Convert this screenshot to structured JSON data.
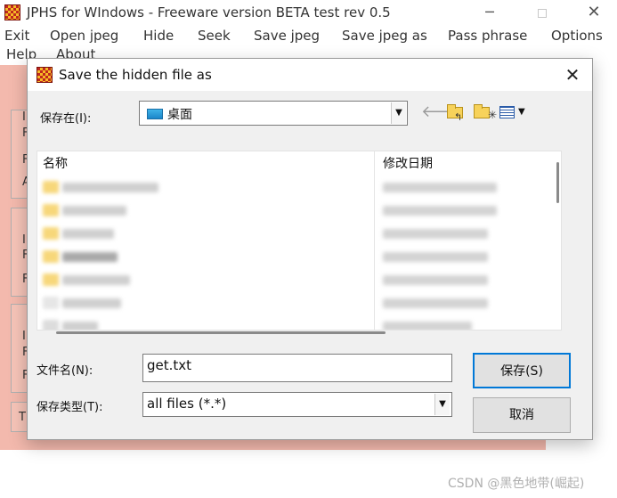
{
  "main_window": {
    "title": "JPHS for WIndows - Freeware version BETA test rev 0.5",
    "menu": [
      "Exit",
      "Open jpeg",
      "Hide",
      "Seek",
      "Save jpeg",
      "Save jpeg as",
      "Pass phrase",
      "Options",
      "Help",
      "About"
    ],
    "panel_letters": [
      "I",
      "F",
      "F",
      "A",
      "I",
      "F",
      "F",
      "I",
      "F",
      "F",
      "Tl"
    ]
  },
  "dialog": {
    "title": "Save the hidden file as",
    "look_in_label": "保存在(I):",
    "look_in_value": "桌面",
    "columns": {
      "name": "名称",
      "date": "修改日期"
    },
    "filename_label": "文件名(N):",
    "filename_value": "get.txt",
    "filetype_label": "保存类型(T):",
    "filetype_value": "all files (*.*)",
    "save_button": "保存(S)",
    "cancel_button": "取消"
  },
  "icons": {
    "back": "back-arrow-icon",
    "up": "up-folder-icon",
    "new_folder": "new-folder-icon",
    "view": "view-menu-icon",
    "desktop": "desktop-icon",
    "close": "close-icon",
    "dropdown": "chevron-down-icon"
  },
  "colors": {
    "main_client_bg": "#f3b9ad",
    "dialog_bg": "#f0f0f0",
    "default_button_border": "#0078d7",
    "folder_yellow": "#f7d25a"
  },
  "watermark": "CSDN @黑色地带(崛起)"
}
